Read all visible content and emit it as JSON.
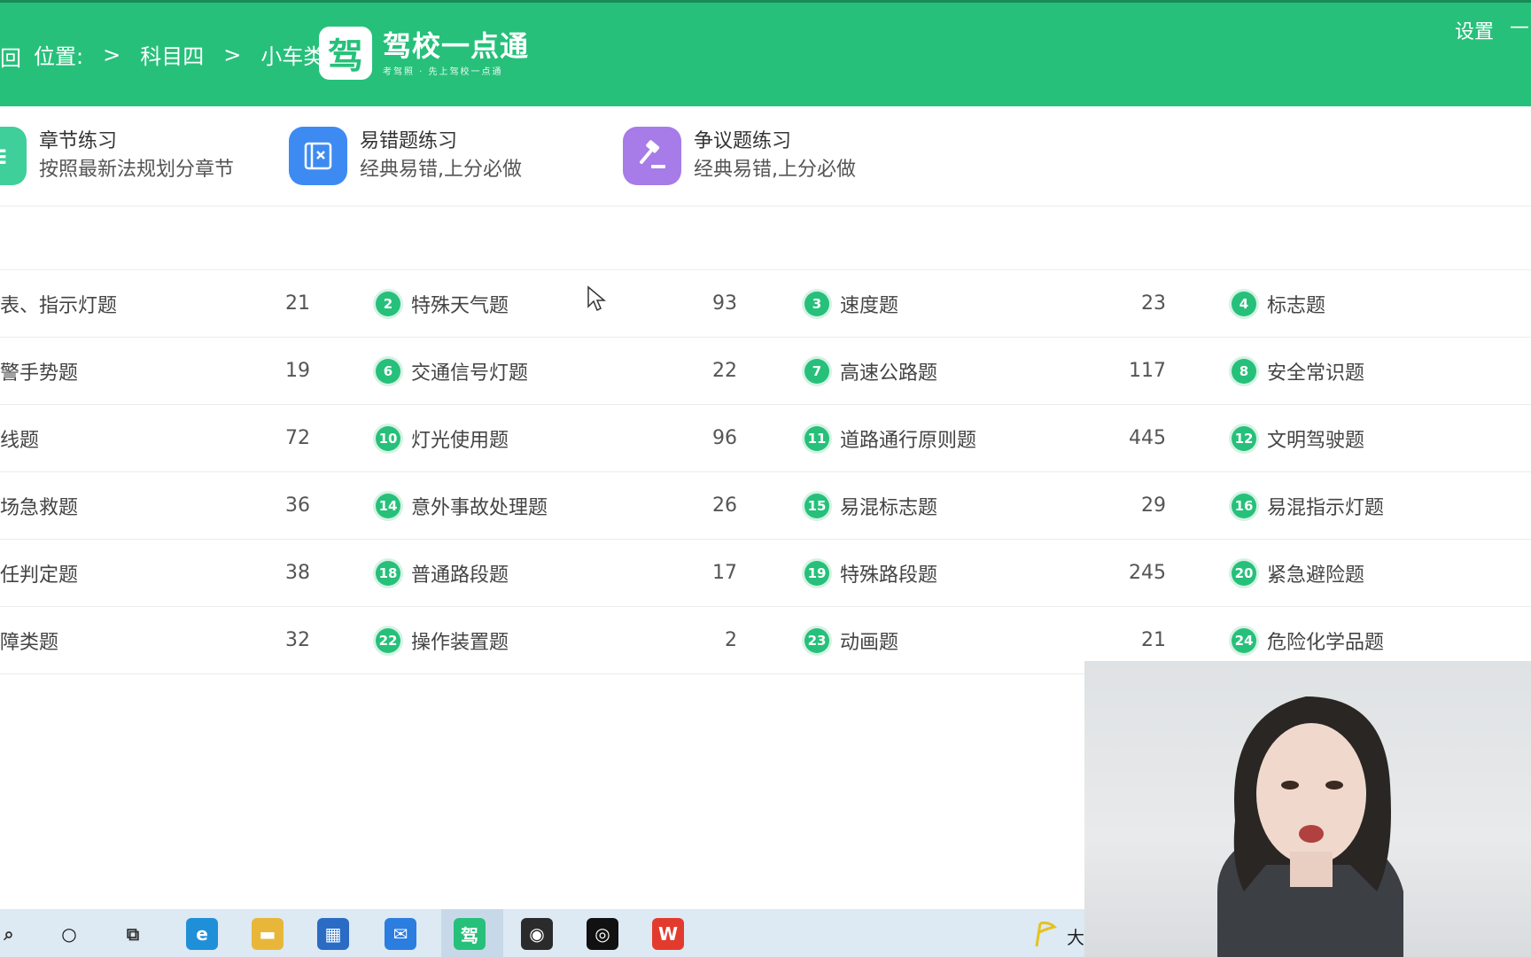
{
  "header": {
    "back_glyph": "回",
    "breadcrumb": {
      "prefix": "位置:",
      "sep1": ">",
      "subject": "科目四",
      "sep2": ">",
      "vehicle": "小车类"
    },
    "logo": {
      "badge": "驾",
      "title": "驾校一点通",
      "slogan": "考驾照 · 先上驾校一点通"
    },
    "settings_label": "设置",
    "minimize_glyph": "—"
  },
  "modes": [
    {
      "title": "章节练习",
      "desc": "按照最新法规划分章节",
      "icon": "list-icon",
      "color": "#3fcf9a"
    },
    {
      "title": "易错题练习",
      "desc": "经典易错,上分必做",
      "icon": "wrong-note-icon",
      "color": "#3d8bf2"
    },
    {
      "title": "争议题练习",
      "desc": "经典易错,上分必做",
      "icon": "gavel-icon",
      "color": "#a77be8"
    }
  ],
  "categories": [
    [
      {
        "num": "",
        "name": "仪表、指示灯题",
        "count": "21"
      },
      {
        "num": "2",
        "name": "特殊天气题",
        "count": "93"
      },
      {
        "num": "3",
        "name": "速度题",
        "count": "23"
      },
      {
        "num": "4",
        "name": "标志题",
        "count": ""
      }
    ],
    [
      {
        "num": "",
        "name": "交警手势题",
        "count": "19"
      },
      {
        "num": "6",
        "name": "交通信号灯题",
        "count": "22"
      },
      {
        "num": "7",
        "name": "高速公路题",
        "count": "117"
      },
      {
        "num": "8",
        "name": "安全常识题",
        "count": ""
      }
    ],
    [
      {
        "num": "",
        "name": "标线题",
        "count": "72"
      },
      {
        "num": "10",
        "name": "灯光使用题",
        "count": "96"
      },
      {
        "num": "11",
        "name": "道路通行原则题",
        "count": "445"
      },
      {
        "num": "12",
        "name": "文明驾驶题",
        "count": ""
      }
    ],
    [
      {
        "num": "",
        "name": "现场急救题",
        "count": "36"
      },
      {
        "num": "14",
        "name": "意外事故处理题",
        "count": "26"
      },
      {
        "num": "15",
        "name": "易混标志题",
        "count": "29"
      },
      {
        "num": "16",
        "name": "易混指示灯题",
        "count": ""
      }
    ],
    [
      {
        "num": "",
        "name": "责任判定题",
        "count": "38"
      },
      {
        "num": "18",
        "name": "普通路段题",
        "count": "17"
      },
      {
        "num": "19",
        "name": "特殊路段题",
        "count": "245"
      },
      {
        "num": "20",
        "name": "紧急避险题",
        "count": ""
      }
    ],
    [
      {
        "num": "",
        "name": "故障类题",
        "count": "32"
      },
      {
        "num": "22",
        "name": "操作装置题",
        "count": "2"
      },
      {
        "num": "23",
        "name": "动画题",
        "count": "21"
      },
      {
        "num": "24",
        "name": "危险化学品题",
        "count": ""
      }
    ]
  ],
  "taskbar": {
    "items": [
      {
        "name": "search-icon",
        "glyph": "⌕",
        "color": "#333"
      },
      {
        "name": "cortana-icon",
        "glyph": "○",
        "color": "#111"
      },
      {
        "name": "task-view-icon",
        "glyph": "⧉",
        "color": "#333"
      },
      {
        "name": "edge-browser-icon",
        "glyph": "e",
        "color": "#1f8fd8"
      },
      {
        "name": "file-explorer-icon",
        "glyph": "▬",
        "color": "#e8b739"
      },
      {
        "name": "store-icon",
        "glyph": "▦",
        "color": "#2a6cc4"
      },
      {
        "name": "mail-icon",
        "glyph": "✉",
        "color": "#2b7de0"
      },
      {
        "name": "jiaxiao-app-icon",
        "glyph": "驾",
        "color": "#26c07a"
      },
      {
        "name": "obs-icon",
        "glyph": "◉",
        "color": "#2b2b2b"
      },
      {
        "name": "camera-app-icon",
        "glyph": "◎",
        "color": "#111"
      },
      {
        "name": "wps-icon",
        "glyph": "W",
        "color": "#e23b2e"
      }
    ],
    "tray_text": "大"
  },
  "webcam": {
    "label": "presenter-webcam"
  }
}
